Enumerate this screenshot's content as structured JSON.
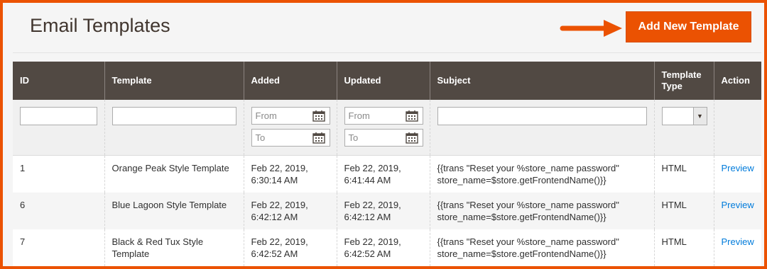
{
  "page": {
    "title": "Email Templates",
    "add_button": "Add New Template"
  },
  "colors": {
    "accent": "#eb5202",
    "header_bg": "#514943",
    "link": "#007bdb"
  },
  "grid": {
    "columns": [
      "ID",
      "Template",
      "Added",
      "Updated",
      "Subject",
      "Template Type",
      "Action"
    ],
    "filters": {
      "added_from_placeholder": "From",
      "added_to_placeholder": "To",
      "updated_from_placeholder": "From",
      "updated_to_placeholder": "To",
      "type_selected": ""
    },
    "rows": [
      {
        "id": "1",
        "template": "Orange Peak Style Template",
        "added": "Feb 22, 2019, 6:30:14 AM",
        "updated": "Feb 22, 2019, 6:41:44 AM",
        "subject": "{{trans \"Reset your %store_name password\" store_name=$store.getFrontendName()}}",
        "type": "HTML",
        "action": "Preview"
      },
      {
        "id": "6",
        "template": "Blue Lagoon Style Template",
        "added": "Feb 22, 2019, 6:42:12 AM",
        "updated": "Feb 22, 2019, 6:42:12 AM",
        "subject": "{{trans \"Reset your %store_name password\" store_name=$store.getFrontendName()}}",
        "type": "HTML",
        "action": "Preview"
      },
      {
        "id": "7",
        "template": "Black & Red Tux Style Template",
        "added": "Feb 22, 2019, 6:42:52 AM",
        "updated": "Feb 22, 2019, 6:42:52 AM",
        "subject": "{{trans \"Reset your %store_name password\" store_name=$store.getFrontendName()}}",
        "type": "HTML",
        "action": "Preview"
      }
    ]
  },
  "icons": {
    "calendar": "calendar-icon",
    "arrow": "arrow-right-icon",
    "dropdown": "chevron-down-icon"
  }
}
